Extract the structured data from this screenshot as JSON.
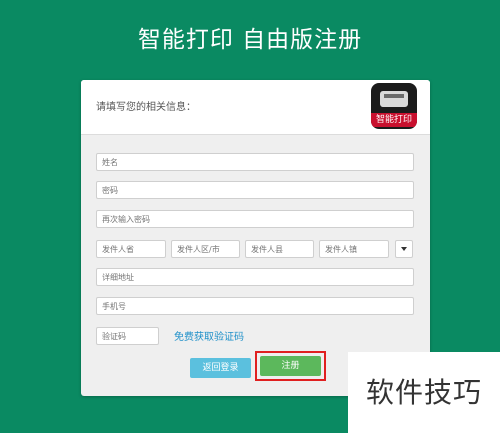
{
  "page": {
    "title": "智能打印  自由版注册"
  },
  "form": {
    "subtitle": "请填写您的相关信息：",
    "logo_text": "智能打印",
    "name_placeholder": "姓名",
    "password_placeholder": "密码",
    "confirm_password_placeholder": "再次输入密码",
    "province_placeholder": "发件人省",
    "district_placeholder": "发件人区/市",
    "county_placeholder": "发件人县",
    "town_placeholder": "发件人镇",
    "address_placeholder": "详细地址",
    "phone_placeholder": "手机号",
    "captcha_placeholder": "验证码",
    "sms_link": "免费获取验证码",
    "back_label": "返回登录",
    "register_label": "注册"
  },
  "watermark": {
    "text": "软件技巧"
  },
  "colors": {
    "background": "#0a8a62",
    "back_button": "#5bc0de",
    "register_button": "#5cb85c",
    "highlight": "#e02020"
  }
}
